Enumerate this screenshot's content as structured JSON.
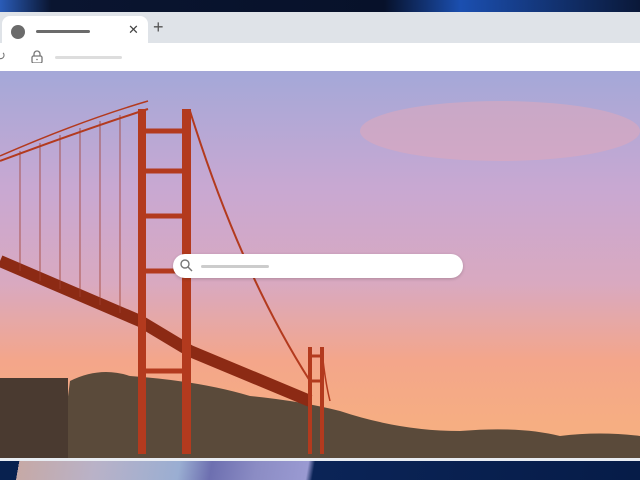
{
  "browser": {
    "tab": {
      "favicon_icon": "circle-favicon-icon",
      "close_icon": "close-icon"
    },
    "new_tab_icon": "plus-icon",
    "toolbar": {
      "reload_icon": "reload-icon",
      "lock_icon": "lock-icon"
    }
  },
  "search": {
    "icon": "search-icon"
  },
  "background": {
    "subject": "golden-gate-bridge-sunset"
  },
  "colors": {
    "tabstrip": "#dfe3e8",
    "bridge": "#b33a1e",
    "sky_top": "#9aa6d6",
    "sky_bottom": "#f4a77e"
  }
}
